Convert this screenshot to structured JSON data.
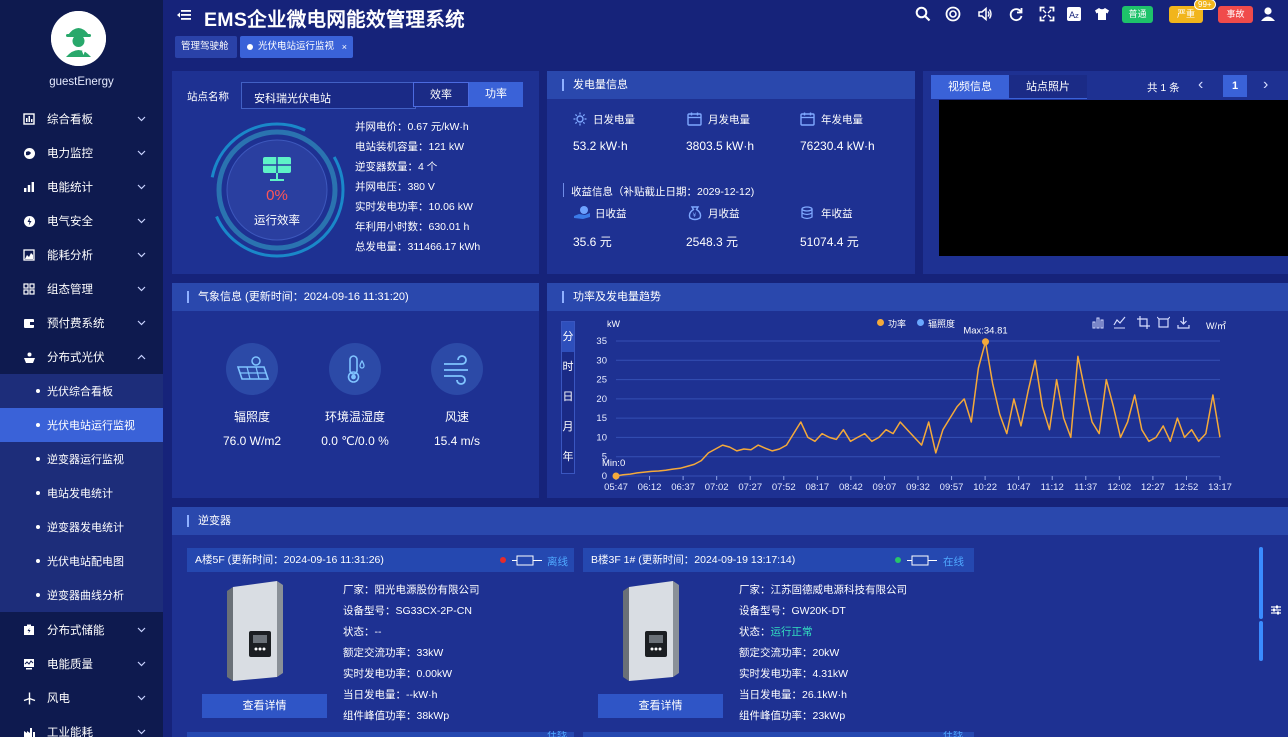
{
  "user": {
    "name": "guestEnergy"
  },
  "sidebar": {
    "items": [
      {
        "label": "综合看板",
        "icon": "dashboard-icon"
      },
      {
        "label": "电力监控",
        "icon": "globe-icon"
      },
      {
        "label": "电能统计",
        "icon": "bar-chart-icon"
      },
      {
        "label": "电气安全",
        "icon": "lightning-shield-icon"
      },
      {
        "label": "能耗分析",
        "icon": "area-chart-icon"
      },
      {
        "label": "组态管理",
        "icon": "grid-icon"
      },
      {
        "label": "预付费系统",
        "icon": "wallet-icon"
      },
      {
        "label": "分布式光伏",
        "icon": "solar-icon"
      }
    ],
    "sub_items": [
      {
        "label": "光伏综合看板"
      },
      {
        "label": "光伏电站运行监视"
      },
      {
        "label": "逆变器运行监视"
      },
      {
        "label": "电站发电统计"
      },
      {
        "label": "逆变器发电统计"
      },
      {
        "label": "光伏电站配电图"
      },
      {
        "label": "逆变器曲线分析"
      }
    ],
    "bottom_items": [
      {
        "label": "分布式储能",
        "icon": "battery-icon"
      },
      {
        "label": "电能质量",
        "icon": "monitor-icon"
      },
      {
        "label": "风电",
        "icon": "wind-turbine-icon"
      },
      {
        "label": "工业能耗",
        "icon": "factory-icon"
      }
    ]
  },
  "header": {
    "title": "EMS企业微电网能效管理系统",
    "badges": {
      "normal": "普通",
      "severe": "严重",
      "severe_count": "99+",
      "fault": "事故"
    },
    "tabs": {
      "home": "管理驾驶舱",
      "current": "光伏电站运行监视",
      "close": "×"
    }
  },
  "station": {
    "name_label": "站点名称",
    "name_value": "安科瑞光伏电站",
    "toggle": {
      "efficiency": "效率",
      "power": "功率"
    },
    "gauge_value": "0%",
    "gauge_label": "运行效率",
    "params": [
      "并网电价：0.67 元/kW·h",
      "电站装机容量：121 kW",
      "逆变器数量：4 个",
      "并网电压：380 V",
      "实时发电功率：10.06 kW",
      "年利用小时数：630.01 h",
      "总发电量：311466.17 kWh"
    ]
  },
  "generation": {
    "title": "发电量信息",
    "daily_label": "日发电量",
    "daily_value": "53.2 kW·h",
    "monthly_label": "月发电量",
    "monthly_value": "3803.5 kW·h",
    "yearly_label": "年发电量",
    "yearly_value": "76230.4 kW·h",
    "income_title": "收益信息（补贴截止日期：2029-12-12)",
    "daily_income_label": "日收益",
    "daily_income_value": "35.6 元",
    "monthly_income_label": "月收益",
    "monthly_income_value": "2548.3 元",
    "yearly_income_label": "年收益",
    "yearly_income_value": "51074.4 元"
  },
  "video": {
    "tab_video": "视频信息",
    "tab_photo": "站点照片",
    "total": "共 1 条",
    "page": "1",
    "prev": "‹",
    "next": "›"
  },
  "weather": {
    "title": "气象信息 (更新时间：2024-09-16 11:31:20)",
    "irradiance_label": "辐照度",
    "irradiance_value": "76.0 W/m2",
    "temp_label": "环境温湿度",
    "temp_value": "0.0 ℃/0.0 %",
    "wind_label": "风速",
    "wind_value": "15.4 m/s"
  },
  "trend": {
    "title": "功率及发电量趋势",
    "period_tabs": [
      "分",
      "时",
      "日",
      "月",
      "年"
    ]
  },
  "chart_data": {
    "type": "line",
    "ylabel_left": "kW",
    "ylabel_right": "W/㎡",
    "legend": [
      "功率",
      "辐照度"
    ],
    "legend_position": "top",
    "ylim": [
      0,
      35
    ],
    "yticks": [
      "0",
      "5",
      "10",
      "15",
      "20",
      "25",
      "30",
      "35"
    ],
    "xticks": [
      "05:47",
      "06:12",
      "06:37",
      "07:02",
      "07:27",
      "07:52",
      "08:17",
      "08:42",
      "09:07",
      "09:32",
      "09:57",
      "10:22",
      "10:47",
      "11:12",
      "11:37",
      "12:02",
      "12:27",
      "12:52",
      "13:17"
    ],
    "max_label": "Max:34.81",
    "min_label": "Min:0",
    "series": [
      {
        "name": "功率",
        "color": "#f4a93a",
        "values": [
          0,
          0.3,
          0.5,
          0.8,
          1,
          1.2,
          1.3,
          1.5,
          1.8,
          2,
          2.5,
          3,
          4,
          6,
          7,
          8,
          7.5,
          6.5,
          7,
          6.8,
          8,
          7.2,
          6.5,
          7,
          8,
          11,
          14,
          10,
          9,
          11,
          10,
          9.5,
          12,
          9,
          10,
          11,
          9,
          10,
          12,
          11,
          14,
          12,
          10,
          8,
          14,
          6,
          12,
          15,
          18,
          20,
          14,
          28,
          34.81,
          24,
          16,
          11,
          20,
          13,
          22,
          30,
          18,
          12,
          25,
          15,
          10,
          31,
          22,
          14,
          11,
          25,
          18,
          10,
          14,
          21,
          12,
          9,
          10,
          13,
          9,
          15,
          10,
          12,
          9,
          11,
          21,
          10
        ]
      }
    ],
    "grid": true
  },
  "inverters": {
    "title": "逆变器",
    "cards": [
      {
        "head": "A楼5F (更新时间：2024-09-16 11:31:26)",
        "status": "离线",
        "status_color": "#e52b2b",
        "vendor": "厂家：阳光电源股份有限公司",
        "model": "设备型号：SG33CX-2P-CN",
        "state": "状态：--",
        "rated": "额定交流功率：33kW",
        "realtime": "实时发电功率：0.00kW",
        "daily": "当日发电量：--kW·h",
        "peak": "组件峰值功率：38kWp",
        "detail": "查看详情"
      },
      {
        "head": "B楼3F 1# (更新时间：2024-09-19 13:17:14)",
        "status": "在线",
        "status_color": "#27c46a",
        "vendor": "厂家：江苏固德威电源科技有限公司",
        "model": "设备型号：GW20K-DT",
        "state_label": "状态：",
        "state_value": "运行正常",
        "rated": "额定交流功率：20kW",
        "realtime": "实时发电功率：4.31kW",
        "daily": "当日发电量：26.1kW·h",
        "peak": "组件峰值功率：23kWp",
        "detail": "查看详情"
      }
    ],
    "third_status": "在线",
    "fourth_status": "在线"
  }
}
